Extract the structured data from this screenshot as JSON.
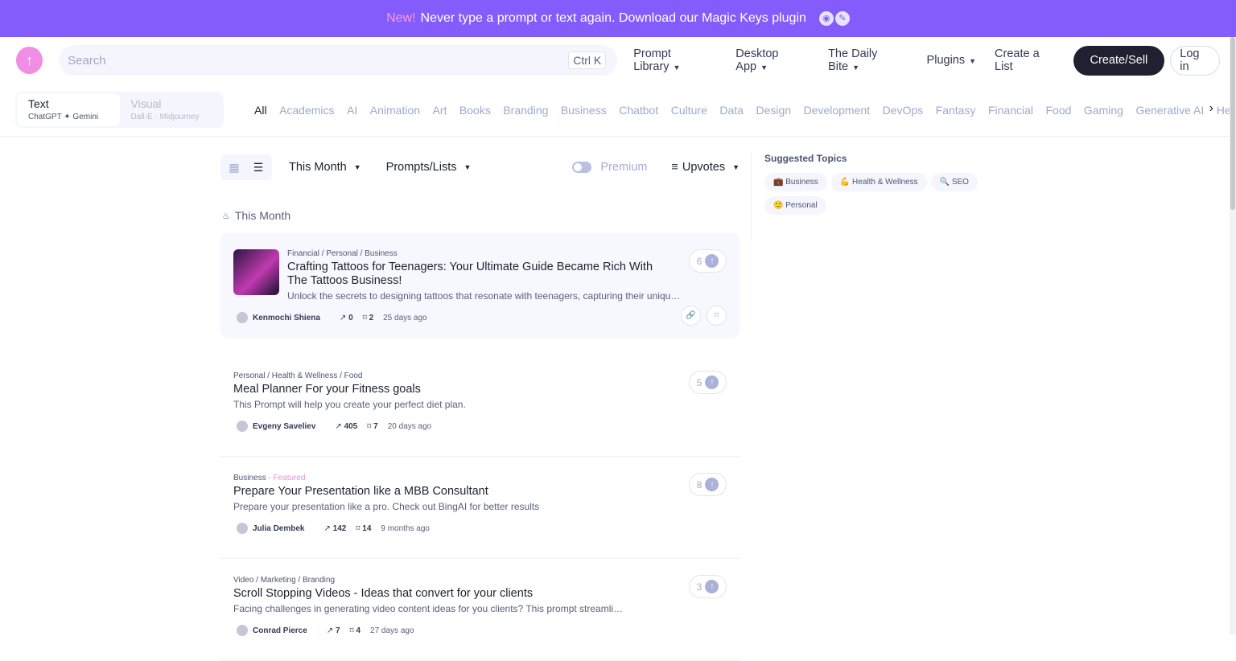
{
  "banner": {
    "new": "New!",
    "text": "Never type a prompt or text again. Download our Magic Keys plugin"
  },
  "nav": {
    "search_placeholder": "Search",
    "shortcut": "Ctrl K",
    "menu": [
      "Prompt Library",
      "Desktop App",
      "The Daily Bite",
      "Plugins",
      "Create a List"
    ],
    "menu_dropdown": [
      true,
      true,
      true,
      true,
      false
    ],
    "create": "Create/Sell",
    "login": "Log in"
  },
  "mode": {
    "text": {
      "label": "Text",
      "sub": "ChatGPT ✦ Gemini"
    },
    "visual": {
      "label": "Visual",
      "sub": "Dall-E · Midjourney"
    }
  },
  "categories": [
    "All",
    "Academics",
    "AI",
    "Animation",
    "Art",
    "Books",
    "Branding",
    "Business",
    "Chatbot",
    "Culture",
    "Data",
    "Design",
    "Development",
    "DevOps",
    "Fantasy",
    "Financial",
    "Food",
    "Gaming",
    "Generative AI",
    "Health"
  ],
  "toolbar": {
    "period": "This Month",
    "type": "Prompts/Lists",
    "premium": "Premium",
    "sort": "Upvotes"
  },
  "section_title": "This Month",
  "items": [
    {
      "cat": "Financial / Personal / Business",
      "featured": "",
      "title": "Crafting Tattoos for Teenagers: Your Ultimate Guide Became Rich With The Tattoos Business!",
      "desc": "Unlock the secrets to designing tattoos that resonate with teenagers, capturing their unique st...",
      "author": "Kenmochi Shiena",
      "uses": "0",
      "saves": "2",
      "ago": "25 days ago",
      "votes": "6"
    },
    {
      "cat": "Personal / Health & Wellness / Food",
      "featured": "",
      "title": "Meal Planner For your Fitness goals",
      "desc": "This Prompt will help you create your perfect diet plan.",
      "author": "Evgeny Saveliev",
      "uses": "405",
      "saves": "7",
      "ago": "20 days ago",
      "votes": "5"
    },
    {
      "cat": "Business",
      "featured": "Featured",
      "title": "Prepare Your Presentation like a MBB Consultant",
      "desc": "Prepare your presentation like a pro. Check out BingAI for better results",
      "author": "Julia Dembek",
      "uses": "142",
      "saves": "14",
      "ago": "9 months ago",
      "votes": "8"
    },
    {
      "cat": "Video / Marketing / Branding",
      "featured": "",
      "title": "Scroll Stopping Videos - Ideas that convert for your clients",
      "desc": "Facing challenges in generating video content ideas for you clients? This prompt streamlines the process, g...",
      "author": "Conrad Pierce",
      "uses": "7",
      "saves": "4",
      "ago": "27 days ago",
      "votes": "3"
    }
  ],
  "suggested": {
    "title": "Suggested Topics",
    "topics": [
      {
        "icon": "💼",
        "label": "Business"
      },
      {
        "icon": "💪",
        "label": "Health & Wellness"
      },
      {
        "icon": "🔍",
        "label": "SEO"
      },
      {
        "icon": "🙂",
        "label": "Personal"
      }
    ]
  }
}
